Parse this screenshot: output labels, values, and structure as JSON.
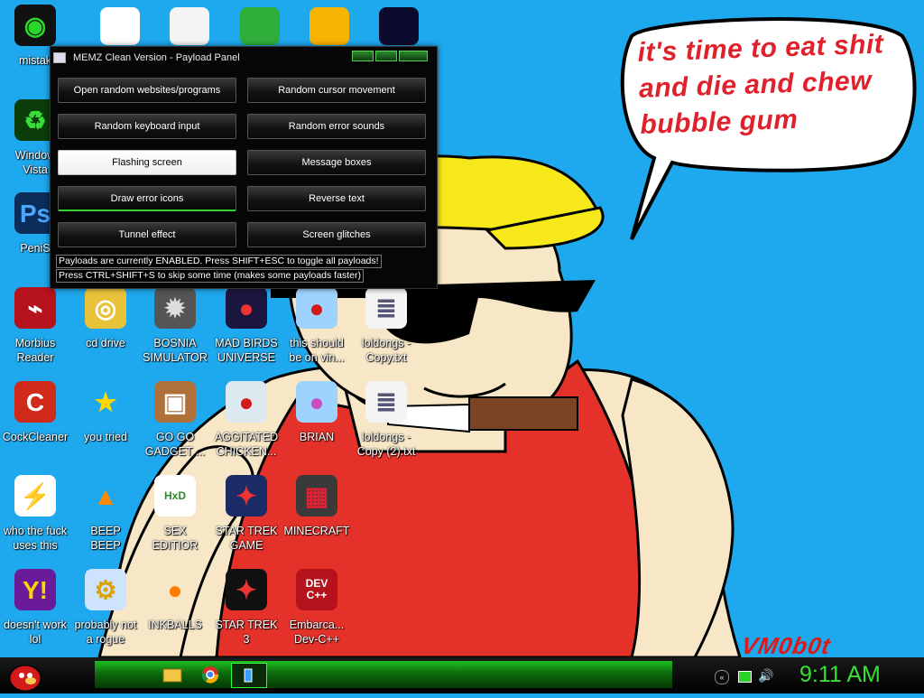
{
  "window": {
    "title": "MEMZ Clean Version - Payload Panel",
    "buttons": [
      {
        "label": "Open random websites/programs"
      },
      {
        "label": "Random cursor movement"
      },
      {
        "label": "Random keyboard input"
      },
      {
        "label": "Random error sounds"
      },
      {
        "label": "Flashing screen"
      },
      {
        "label": "Message boxes"
      },
      {
        "label": "Draw error icons"
      },
      {
        "label": "Reverse text"
      },
      {
        "label": "Tunnel effect"
      },
      {
        "label": "Screen glitches"
      }
    ],
    "status_line1": "Payloads are currently ENABLED. Press SHIFT+ESC to toggle all payloads!",
    "status_line2": "Press CTRL+SHIFT+S to skip some time (makes some payloads faster)"
  },
  "speech_bubble": {
    "line1": "it's time to eat shit",
    "line2": "and die and chew",
    "line3": "bubble gum"
  },
  "signature": "VM0b0t",
  "desktop_icons": [
    {
      "label": "mistak",
      "icon": "razer-icon"
    },
    {
      "label": "Window\nVista",
      "icon": "recycle-bin-icon"
    },
    {
      "label": "PeniS",
      "icon": "photoshop-icon"
    },
    {
      "label": "Morbius\nReader",
      "icon": "pdf-reader-icon"
    },
    {
      "label": "cd drive",
      "icon": "cd-drive-icon"
    },
    {
      "label": "BOSNIA\nSIMULATOR",
      "icon": "mine-icon"
    },
    {
      "label": "MAD BIRDS\nUNIVERSE",
      "icon": "angry-birds-space-icon"
    },
    {
      "label": "this should\nbe on vin...",
      "icon": "angry-bird-icon"
    },
    {
      "label": "loldongs -\nCopy.txt",
      "icon": "text-file-icon"
    },
    {
      "label": "CockCleaner",
      "icon": "ccleaner-icon"
    },
    {
      "label": "you tried",
      "icon": "star-icon"
    },
    {
      "label": "GO GO\nGADGET ...",
      "icon": "briefcase-icon"
    },
    {
      "label": "AGGITATED\nCHICKEN...",
      "icon": "angry-birds-icon"
    },
    {
      "label": "BRIAN",
      "icon": "angry-birds-rio-icon"
    },
    {
      "label": "loldongs -\nCopy (2).txt",
      "icon": "text-file-icon"
    },
    {
      "label": "who the fuck\nuses this",
      "icon": "winamp-icon"
    },
    {
      "label": "BEEP\nBEEP",
      "icon": "vlc-icon"
    },
    {
      "label": "SEX\nEDITIOR",
      "icon": "hxd-icon"
    },
    {
      "label": "STAR TREK\nGAME",
      "icon": "star-wars-birds-icon"
    },
    {
      "label": "MINECRAFT",
      "icon": "minecraft-icon"
    },
    {
      "label": "doesn't work\nlol",
      "icon": "yahoo-messenger-icon"
    },
    {
      "label": "probably not\na rogue",
      "icon": "system-tool-icon"
    },
    {
      "label": "INKBALLS",
      "icon": "inkball-icon"
    },
    {
      "label": "STAR TREK\n3",
      "icon": "star-wars-birds-2-icon"
    },
    {
      "label": "Embarca...\nDev-C++",
      "icon": "dev-cpp-icon"
    }
  ],
  "taskbar": {
    "clock": "9:11 AM"
  },
  "colors": {
    "desktop": "#1ea8ee",
    "accent_green": "#36e036",
    "speech_red": "#e0212c"
  }
}
